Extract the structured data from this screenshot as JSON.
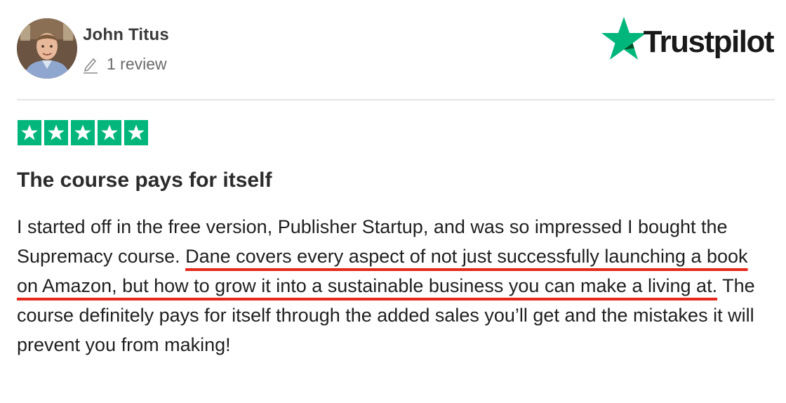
{
  "reviewer": {
    "name": "John Titus",
    "review_count": "1 review"
  },
  "brand": {
    "name": "Trustpilot",
    "star_color": "#00b67a"
  },
  "rating": {
    "stars": 5,
    "max": 5
  },
  "review": {
    "title": "The course pays for itself",
    "body_before": "I started off in the free version, Publisher Startup, and was so impressed I bought the Supremacy course. ",
    "body_highlight": "Dane covers every aspect of not just successfully launching a book on Amazon, but how to grow it into a sustainable business you can make a living at.",
    "body_after": " The course definitely pays for itself through the added sales you’ll get and the mistakes it will prevent you from making!"
  },
  "colors": {
    "accent_green": "#00b67a",
    "highlight_underline": "#e5281b"
  },
  "icons": {
    "edit": "pencil-icon",
    "logo": "trustpilot-star-icon",
    "rating": "star-icon"
  }
}
